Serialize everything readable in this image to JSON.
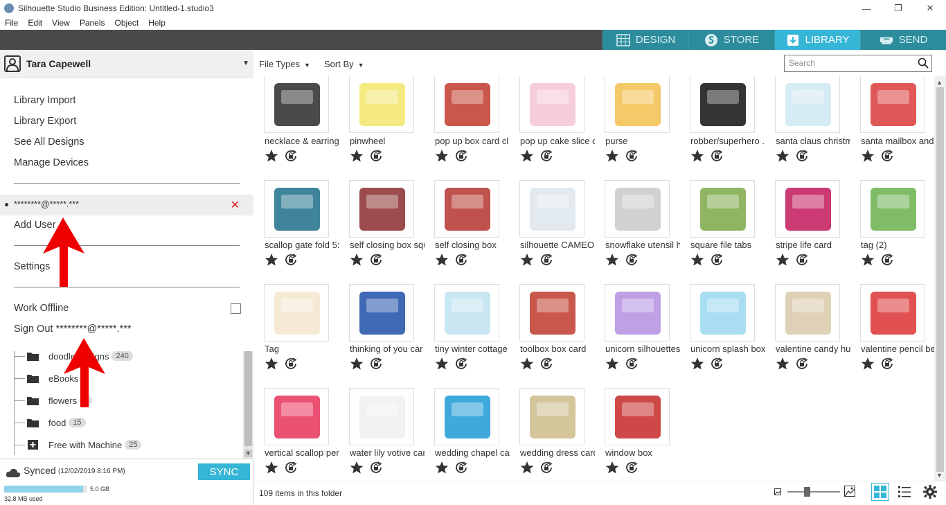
{
  "window": {
    "title": "Silhouette Studio Business Edition: Untitled-1.studio3"
  },
  "menu": [
    "File",
    "Edit",
    "View",
    "Panels",
    "Object",
    "Help"
  ],
  "tabs": [
    {
      "label": "DESIGN",
      "active": false,
      "icon": "grid-icon"
    },
    {
      "label": "STORE",
      "active": false,
      "icon": "silhouette-s-icon"
    },
    {
      "label": "LIBRARY",
      "active": true,
      "icon": "download-icon"
    },
    {
      "label": "SEND",
      "active": false,
      "icon": "cutter-icon"
    }
  ],
  "user": {
    "name": "Tara Capewell"
  },
  "dropdown": {
    "library_import": "Library Import",
    "library_export": "Library Export",
    "see_all": "See All Designs",
    "manage_devices": "Manage Devices",
    "account_email": "********@*****.***",
    "add_user": "Add User",
    "settings": "Settings",
    "work_offline": "Work Offline",
    "work_offline_checked": false,
    "sign_out": "Sign Out ********@*****.***"
  },
  "tree": [
    {
      "label": "doodle designs",
      "count": "240",
      "icon": "folder-icon"
    },
    {
      "label": "eBooks",
      "count": "",
      "icon": "folder-icon"
    },
    {
      "label": "flowers",
      "count": "2",
      "icon": "folder-icon"
    },
    {
      "label": "food",
      "count": "15",
      "icon": "folder-icon"
    },
    {
      "label": "Free with Machine",
      "count": "25",
      "icon": "folder-plus-icon"
    }
  ],
  "sync": {
    "label": "Synced",
    "date": "(12/02/2019 8:16 PM)",
    "button": "SYNC",
    "total": "5.0 GB",
    "used": "32.8 MB used",
    "used_fraction": 0.95
  },
  "toolbar": {
    "file_types": "File Types",
    "sort_by": "Sort By",
    "search_placeholder": "Search"
  },
  "items": [
    "necklace & earring",
    "pinwheel",
    "pop up box card cl",
    "pop up cake slice c",
    "purse",
    "robber/superhero .",
    "santa claus christm",
    "santa mailbox and",
    "scallop gate fold 5:",
    "self closing box squ",
    "self closing box",
    "silhouette CAMEO.",
    "snowflake utensil h",
    "square file tabs",
    "stripe life card",
    "tag (2)",
    "Tag",
    "thinking of you car",
    "tiny winter cottage",
    "toolbox box card",
    "unicorn silhouettes",
    "unicorn splash box",
    "valentine candy hu",
    "valentine pencil be",
    "vertical scallop per",
    "water lily votive car",
    "wedding chapel ca",
    "wedding dress card",
    "window box"
  ],
  "status": {
    "item_count": "109 items in this folder"
  },
  "colors": {
    "accent": "#35b6d6",
    "tab": "#2c8c9c",
    "topbar": "#4a4a4a",
    "arrow": "#ee0000"
  }
}
